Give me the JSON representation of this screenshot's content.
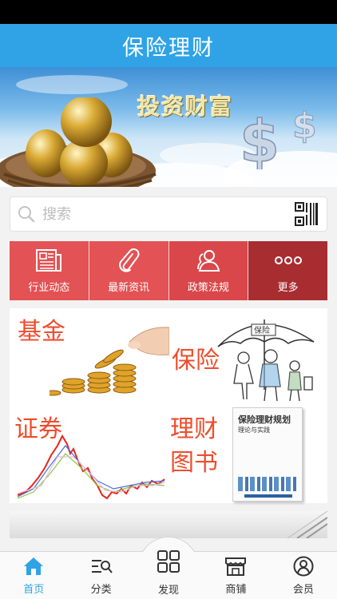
{
  "header": {
    "title": "保险理财"
  },
  "banner": {
    "caption": "投资财富",
    "dot_count": 4
  },
  "search": {
    "placeholder": "搜索",
    "icon": "search-icon",
    "scan_icon": "qr-code-icon"
  },
  "categories": [
    {
      "label": "行业动态",
      "icon": "newspaper-icon",
      "color": "#e35254"
    },
    {
      "label": "最新资讯",
      "icon": "paperclip-icon",
      "color": "#e35254"
    },
    {
      "label": "政策法规",
      "icon": "people-icon",
      "color": "#d9474a"
    },
    {
      "label": "更多",
      "icon": "more-dots-icon",
      "color": "#a82d31"
    }
  ],
  "promos": [
    {
      "label": "基金"
    },
    {
      "label": "保险"
    },
    {
      "label": "证券"
    },
    {
      "label": "理财图书",
      "lines": [
        "理财",
        "图书"
      ]
    }
  ],
  "book": {
    "title": "保险理财规划",
    "subtitle": "理论与实践"
  },
  "tabbar": {
    "items": [
      {
        "label": "首页",
        "icon": "home-icon",
        "active": true
      },
      {
        "label": "分类",
        "icon": "category-search-icon",
        "active": false
      },
      {
        "label": "发现",
        "icon": "grid-icon",
        "active": false
      },
      {
        "label": "商铺",
        "icon": "shop-icon",
        "active": false
      },
      {
        "label": "会员",
        "icon": "user-icon",
        "active": false
      }
    ]
  },
  "colors": {
    "primary": "#2fa3e6",
    "accent_red": "#e35254",
    "promo_text": "#ee4d2d"
  }
}
